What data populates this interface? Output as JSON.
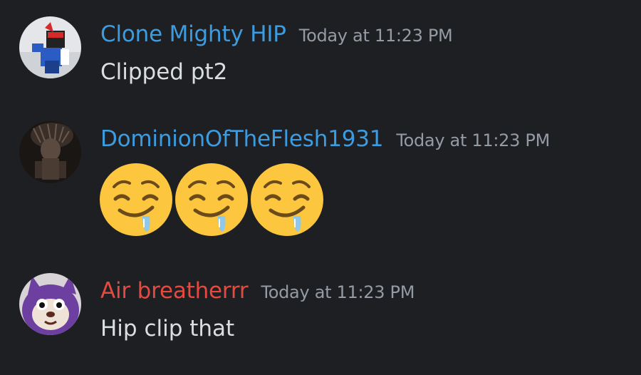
{
  "messages": [
    {
      "author": "Clone Mighty HIP",
      "author_color": "#3d9ce0",
      "timestamp": "Today at 11:23 PM",
      "text": "Clipped pt2",
      "avatar": "roblox-character-avatar"
    },
    {
      "author": "DominionOfTheFlesh1931",
      "author_color": "#3d9ce0",
      "timestamp": "Today at 11:23 PM",
      "emojis": [
        "drooling-face-emoji",
        "drooling-face-emoji",
        "drooling-face-emoji"
      ],
      "avatar": "dark-creature-avatar"
    },
    {
      "author": "Air breatherrr",
      "author_color": "#e5493f",
      "timestamp": "Today at 11:23 PM",
      "text": "Hip clip that",
      "avatar": "purple-tattletail-avatar"
    }
  ]
}
